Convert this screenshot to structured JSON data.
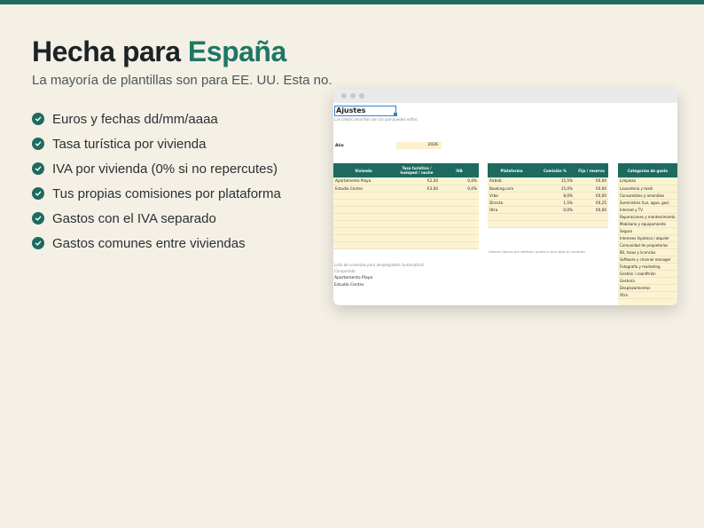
{
  "hero": {
    "title_main": "Hecha para ",
    "title_accent": "España",
    "subtitle": "La mayoría de plantillas son para EE. UU. Esta no."
  },
  "features": [
    "Euros y fechas dd/mm/aaaa",
    "Tasa turística por vivienda",
    "IVA por vivienda (0% si no repercutes)",
    "Tus propias comisiones por plataforma",
    "Gastos con el IVA separado",
    "Gastos comunes entre viviendas"
  ],
  "sheet": {
    "title": "Ajustes",
    "note": "Las celdas amarillas son las que puedes editar.",
    "year_label": "Año",
    "year_value": "2026",
    "viviendas": {
      "headers": [
        "Vivienda",
        "Tasa turística / huésped / noche",
        "IVA"
      ],
      "rows": [
        [
          "Apartamento Playa",
          "€2,50",
          "0,0%"
        ],
        [
          "Estudio Centro",
          "€3,00",
          "0,0%"
        ]
      ]
    },
    "plataformas": {
      "headers": [
        "Plataforma",
        "Comisión %",
        "Fijo / reserva"
      ],
      "rows": [
        [
          "Airbnb",
          "15,5%",
          "€0,00"
        ],
        [
          "Booking.com",
          "15,0%",
          "€0,00"
        ],
        [
          "Vrbo",
          "8,0%",
          "€0,00"
        ],
        [
          "Directa",
          "1,5%",
          "€0,25"
        ],
        [
          "Otra",
          "0,0%",
          "€0,00"
        ]
      ],
      "note": "Valores típicos por defecto: ponte lo que diga tu contrato."
    },
    "categorias": {
      "header": "Categorías de gasto",
      "items": [
        "Limpieza",
        "Lavandería y textil",
        "Consumibles y amenities",
        "Suministros (luz, agua, gas)",
        "Internet y TV",
        "Reparaciones y mantenimiento",
        "Mobiliario y equipamiento",
        "Seguro",
        "Intereses hipoteca / alquiler",
        "Comunidad de propietarios",
        "IBI, tasas y licencias",
        "Software y channel manager",
        "Fotografía y marketing",
        "Gestión / coanfitrión",
        "Gestoría",
        "Desplazamientos",
        "Otra"
      ]
    },
    "list_note": "Lista de viviendas para desplegables (automática).",
    "list_sub": "Compartido",
    "list_items": [
      "Apartamento Playa",
      "Estudio Centro"
    ]
  },
  "colors": {
    "brand": "#1d6b5f",
    "accent_text": "#1d7766",
    "background": "#f4f0e6",
    "editable_cell": "#fbf3d2"
  },
  "icons": {
    "feature_bullet": "check-circle-icon"
  }
}
